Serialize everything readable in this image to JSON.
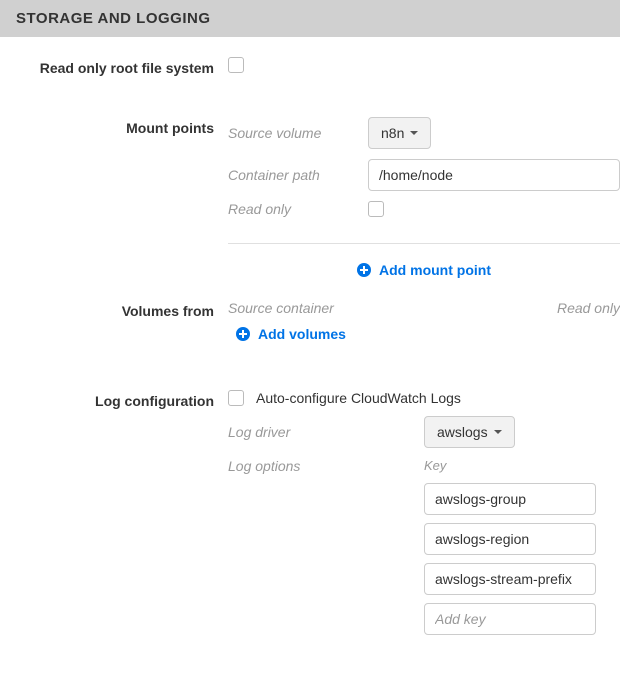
{
  "section_title": "STORAGE AND LOGGING",
  "rows": {
    "readonly_root": {
      "label": "Read only root file system"
    },
    "mount_points": {
      "label": "Mount points",
      "source_volume_label": "Source volume",
      "source_volume_value": "n8n",
      "container_path_label": "Container path",
      "container_path_value": "/home/node",
      "read_only_label": "Read only",
      "add_label": "Add mount point"
    },
    "volumes_from": {
      "label": "Volumes from",
      "source_container_label": "Source container",
      "read_only_label": "Read only",
      "add_label": "Add volumes"
    },
    "log_config": {
      "label": "Log configuration",
      "auto_label": "Auto-configure CloudWatch Logs",
      "driver_label": "Log driver",
      "driver_value": "awslogs",
      "options_label": "Log options",
      "key_header": "Key",
      "keys": [
        "awslogs-group",
        "awslogs-region",
        "awslogs-stream-prefix"
      ],
      "add_key_placeholder": "Add key"
    }
  }
}
